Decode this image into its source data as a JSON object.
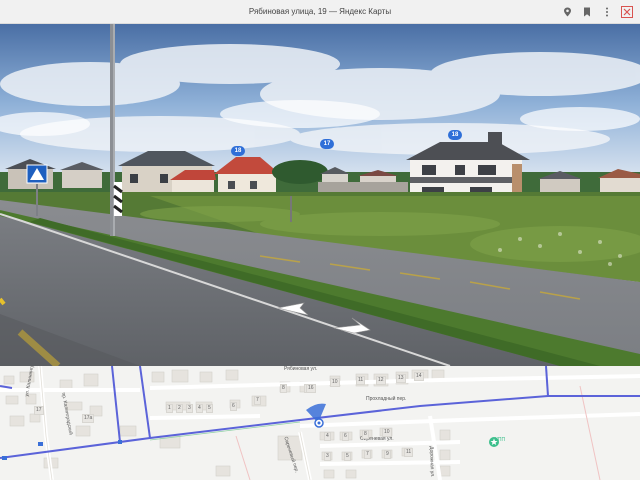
{
  "window": {
    "title": "Рябиновая улица, 19 — Яндекс Карты",
    "icons": [
      "location-pin-icon",
      "bookmark-icon",
      "more-vert-icon",
      "close-icon"
    ]
  },
  "panorama": {
    "house_markers": [
      "18",
      "18",
      "17"
    ]
  },
  "map": {
    "street_labels": {
      "ryabinovaya": "Рябиновая ул.",
      "prohladny": "Прохладный пер.",
      "sirenevaya": "Сиреневая ул.",
      "sirenevy": "Сиреневый пер.",
      "kaliningradskaya": "ул. Калининградская",
      "pr_grafskaya": "пр. Калинградский",
      "dorozhnaya": "Дорожная ул."
    },
    "poi_label": "КПП",
    "building_numbers": [
      "17",
      "1",
      "2",
      "3",
      "4",
      "5",
      "6",
      "7",
      "8",
      "9",
      "10",
      "11",
      "12",
      "13",
      "14",
      "16",
      "17",
      "18",
      "19",
      "20",
      "21",
      "22",
      "23",
      "24",
      "17а",
      "15",
      "2",
      "4",
      "6",
      "8",
      "10",
      "12",
      "14",
      "16",
      "1",
      "3",
      "5",
      "7",
      "9",
      "11",
      "13",
      "15",
      "1",
      "3",
      "5"
    ],
    "colors": {
      "main_road": "#5b63d9",
      "minor_road": "#ffffff",
      "building": "#e8e6e2",
      "poi": "#3cbf8c",
      "marker": "#2f6fd8"
    }
  }
}
